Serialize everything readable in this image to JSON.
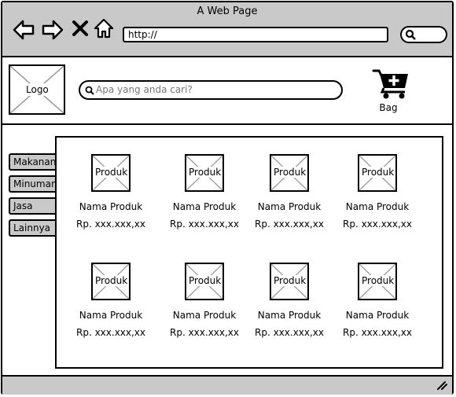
{
  "window": {
    "title": "A Web Page"
  },
  "address_bar": {
    "url": "http://"
  },
  "header": {
    "logo_label": "Logo",
    "search_placeholder": "Apa yang anda cari?",
    "bag_label": "Bag"
  },
  "sidebar": {
    "items": [
      {
        "label": "Makanan"
      },
      {
        "label": "Minuman"
      },
      {
        "label": "Jasa"
      },
      {
        "label": "Lainnya"
      }
    ]
  },
  "products": [
    {
      "image_label": "Produk",
      "name": "Nama Produk",
      "price": "Rp. xxx.xxx,xx"
    },
    {
      "image_label": "Produk",
      "name": "Nama Produk",
      "price": "Rp. xxx.xxx,xx"
    },
    {
      "image_label": "Produk",
      "name": "Nama Produk",
      "price": "Rp. xxx.xxx,xx"
    },
    {
      "image_label": "Produk",
      "name": "Nama Produk",
      "price": "Rp. xxx.xxx,xx"
    },
    {
      "image_label": "Produk",
      "name": "Nama Produk",
      "price": "Rp. xxx.xxx,xx"
    },
    {
      "image_label": "Produk",
      "name": "Nama Produk",
      "price": "Rp. xxx.xxx,xx"
    },
    {
      "image_label": "Produk",
      "name": "Nama Produk",
      "price": "Rp. xxx.xxx,xx"
    },
    {
      "image_label": "Produk",
      "name": "Nama Produk",
      "price": "Rp. xxx.xxx,xx"
    }
  ],
  "icons": {
    "back": "arrow-left-icon",
    "forward": "arrow-right-icon",
    "stop": "close-icon",
    "home": "home-icon",
    "search": "search-icon",
    "cart": "cart-add-icon",
    "resize": "resize-grip-icon"
  },
  "colors": {
    "chrome": "#c9c9c9",
    "border": "#000000",
    "placeholder_text": "#777777"
  }
}
